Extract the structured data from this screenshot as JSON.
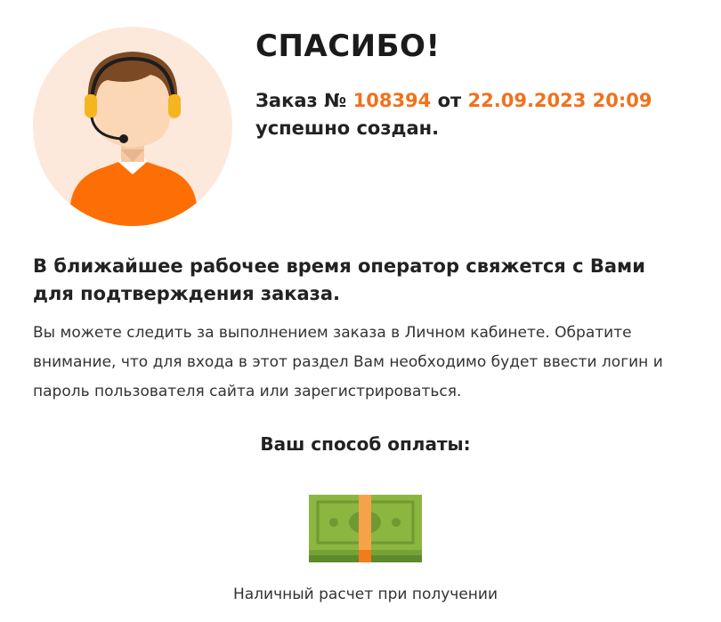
{
  "header": {
    "title": "СПАСИБО!",
    "avatar_icon": "operator-headset-icon"
  },
  "order": {
    "prefix": "Заказ №",
    "number": "108394",
    "from_word": "от",
    "datetime": "22.09.2023 20:09",
    "status": "успешно создан."
  },
  "notice": {
    "heading": "В ближайшее рабочее время оператор свяжется с Вами для подтверждения заказа.",
    "description": "Вы можете следить за выполнением заказа в Личном кабинете. Обратите внимание, что для входа в этот раздел Вам необходимо будет ввести логин и пароль пользователя сайта или зарегистрироваться."
  },
  "payment": {
    "heading": "Ваш способ оплаты:",
    "method": "Наличный расчет при получении",
    "icon": "cash-banknotes-icon"
  },
  "colors": {
    "accent": "#f2711c",
    "avatar_bg": "#fde9dc",
    "cash_green": "#8bb63f"
  }
}
